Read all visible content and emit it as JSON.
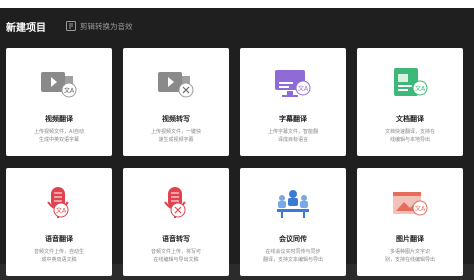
{
  "modal": {
    "title": "新建项目",
    "convert_link": "剪辑转换为音效"
  },
  "cards": [
    {
      "name": "视频翻译",
      "desc_l1": "上传视频文件，AI自动",
      "desc_l2": "生成中英双语字幕",
      "icon": "video-translate-icon"
    },
    {
      "name": "视频转写",
      "desc_l1": "上传视频文件，一键快",
      "desc_l2": "速生成视频字幕",
      "icon": "video-transcribe-icon"
    },
    {
      "name": "字幕翻译",
      "desc_l1": "上传字幕文件，智能翻",
      "desc_l2": "译成目标语言",
      "icon": "subtitle-translate-icon"
    },
    {
      "name": "文档翻译",
      "desc_l1": "文档快速翻译，支持在",
      "desc_l2": "线编辑与本地导出",
      "icon": "document-translate-icon"
    },
    {
      "name": "语音翻译",
      "desc_l1": "音频文件上传，自动生",
      "desc_l2": "成中英双语文稿",
      "icon": "voice-translate-icon"
    },
    {
      "name": "语音转写",
      "desc_l1": "音频文件上传，将写可",
      "desc_l2": "在线编辑与导出文稿",
      "icon": "voice-transcribe-icon"
    },
    {
      "name": "会议同传",
      "desc_l1": "在线会议实时同传与同步",
      "desc_l2": "翻译，支持文本编辑与导出",
      "icon": "meeting-interpret-icon"
    },
    {
      "name": "图片翻译",
      "desc_l1": "多语种图片文字识",
      "desc_l2": "别，支持在线编辑导出",
      "icon": "image-translate-icon"
    }
  ],
  "colors": {
    "purple": "#8e6bd6",
    "green": "#3cb878",
    "red": "#e0434f",
    "blue": "#3a7bd5",
    "gray": "#8a8a8a"
  }
}
